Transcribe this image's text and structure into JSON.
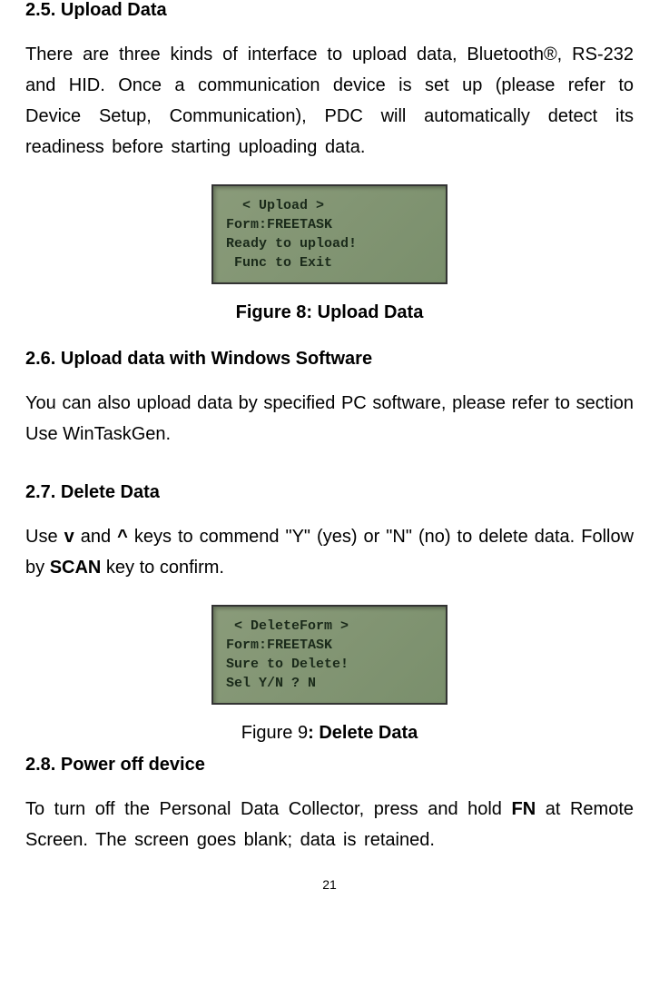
{
  "section25": {
    "heading": "2.5. Upload Data",
    "paragraph": "There are three kinds of interface to upload data, Bluetooth®, RS-232 and HID. Once a communication device is set up (please refer to Device Setup, Communication), PDC will automatically detect its readiness before starting uploading data."
  },
  "figure8": {
    "lcd_line1": "  < Upload >",
    "lcd_line2": "Form:FREETASK",
    "lcd_line3": "Ready to upload!",
    "lcd_line4": " Func to Exit",
    "caption": "Figure 8: Upload Data"
  },
  "section26": {
    "heading": "2.6. Upload data with Windows Software",
    "paragraph": "You can also upload data by specified PC software, please refer to section Use WinTaskGen."
  },
  "section27": {
    "heading": "2.7. Delete Data",
    "p1_part1": "Use ",
    "p1_key_v": "v",
    "p1_part2": " and ",
    "p1_key_caret": "^",
    "p1_part3": " keys to commend \"Y\" (yes) or \"N\" (no) to delete data. Follow by ",
    "p1_scan": "SCAN",
    "p1_part4": " key to confirm."
  },
  "figure9": {
    "lcd_line1": " < DeleteForm >",
    "lcd_line2": "Form:FREETASK",
    "lcd_line3": "Sure to Delete!",
    "lcd_line4": "Sel Y/N ? N",
    "caption_prefix": "Figure 9",
    "caption_bold": ": Delete Data"
  },
  "section28": {
    "heading": "2.8. Power off device",
    "p1_part1": "To turn off the Personal Data Collector, press and hold ",
    "p1_fn": "FN",
    "p1_part2": " at Remote Screen. The screen goes blank; data is retained."
  },
  "page_number": "21"
}
